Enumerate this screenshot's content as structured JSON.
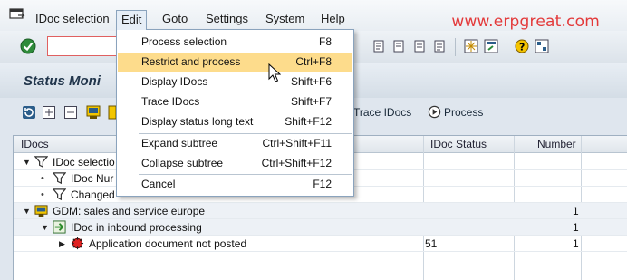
{
  "menubar": {
    "items": [
      {
        "label": "IDoc selection"
      },
      {
        "label": "Edit"
      },
      {
        "label": "Goto"
      },
      {
        "label": "Settings"
      },
      {
        "label": "System"
      },
      {
        "label": "Help"
      }
    ],
    "watermark": "www.erpgreat.com"
  },
  "edit_menu": {
    "items": [
      {
        "label": "Process selection",
        "shortcut": "F8"
      },
      {
        "label": "Restrict and process",
        "shortcut": "Ctrl+F8",
        "highlighted": true
      },
      {
        "label": "Display IDocs",
        "shortcut": "Shift+F6"
      },
      {
        "label": "Trace IDocs",
        "shortcut": "Shift+F7"
      },
      {
        "label": "Display status long text",
        "shortcut": "Shift+F12"
      },
      {
        "label": "Expand subtree",
        "shortcut": "Ctrl+Shift+F11"
      },
      {
        "label": "Collapse subtree",
        "shortcut": "Ctrl+Shift+F12"
      },
      {
        "label": "Cancel",
        "shortcut": "F12"
      }
    ]
  },
  "title": "Status Moni",
  "app_toolbar": {
    "trace_idocs": "Trace IDocs",
    "process": "Process"
  },
  "tree": {
    "columns": [
      "IDocs",
      "IDoc Status",
      "Number"
    ],
    "rows": [
      {
        "label": "IDoc selectio",
        "status": "",
        "number": ""
      },
      {
        "label": "IDoc Nur",
        "status": "",
        "number": ""
      },
      {
        "label": "Changed",
        "status": "",
        "number": ""
      },
      {
        "label": "GDM: sales and service europe",
        "status": "",
        "number": "1"
      },
      {
        "label": "IDoc in inbound processing",
        "status": "",
        "number": "1"
      },
      {
        "label": "Application document not posted",
        "status": "51",
        "number": "1"
      }
    ]
  },
  "colors": {
    "highlight": "#fddc8c",
    "watermark": "#e3393a",
    "accent": "#22364c"
  }
}
